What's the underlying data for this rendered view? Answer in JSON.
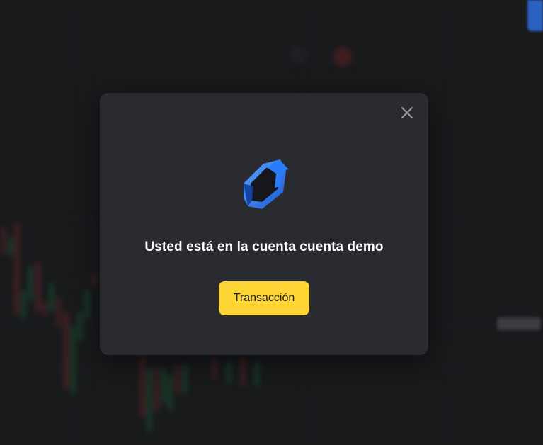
{
  "dialog": {
    "title": "Usted está en la cuenta cuenta demo",
    "cta_label": "Transacción",
    "close_icon": "close-icon",
    "logo_icon": "shield-arrow-logo-icon"
  },
  "colors": {
    "page_bg": "#1e1f22",
    "modal_bg": "#2a2b30",
    "cta_bg": "#fdd534",
    "cta_text": "#1d1e22",
    "title_text": "#ffffff",
    "logo_blue": "#2a7cff",
    "candle_up": "#1f7a45",
    "candle_down": "#8a2f34"
  }
}
